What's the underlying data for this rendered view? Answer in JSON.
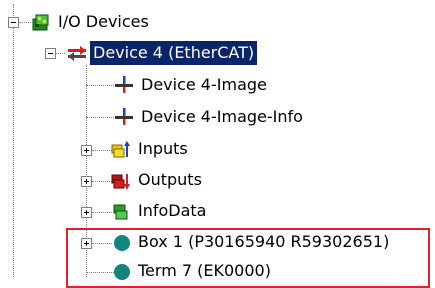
{
  "tree": {
    "root": {
      "label": "I/O Devices",
      "icon": "io-devices-icon"
    },
    "device": {
      "label": "Device 4 (EtherCAT)",
      "icon": "ethercat-device-icon",
      "selected": true
    },
    "children": [
      {
        "label": "Device 4-Image",
        "icon": "process-image-icon"
      },
      {
        "label": "Device 4-Image-Info",
        "icon": "process-image-icon"
      },
      {
        "label": "Inputs",
        "icon": "inputs-icon"
      },
      {
        "label": "Outputs",
        "icon": "outputs-icon"
      },
      {
        "label": "InfoData",
        "icon": "infodata-icon"
      },
      {
        "label": "Box 1 (P30165940 R59302651)",
        "icon": "box-icon"
      },
      {
        "label": "Term 7 (EK0000)",
        "icon": "box-icon"
      }
    ]
  },
  "colors": {
    "selection": "#0a246a",
    "highlight_border": "#e4202e",
    "box_node": "#13857f"
  }
}
